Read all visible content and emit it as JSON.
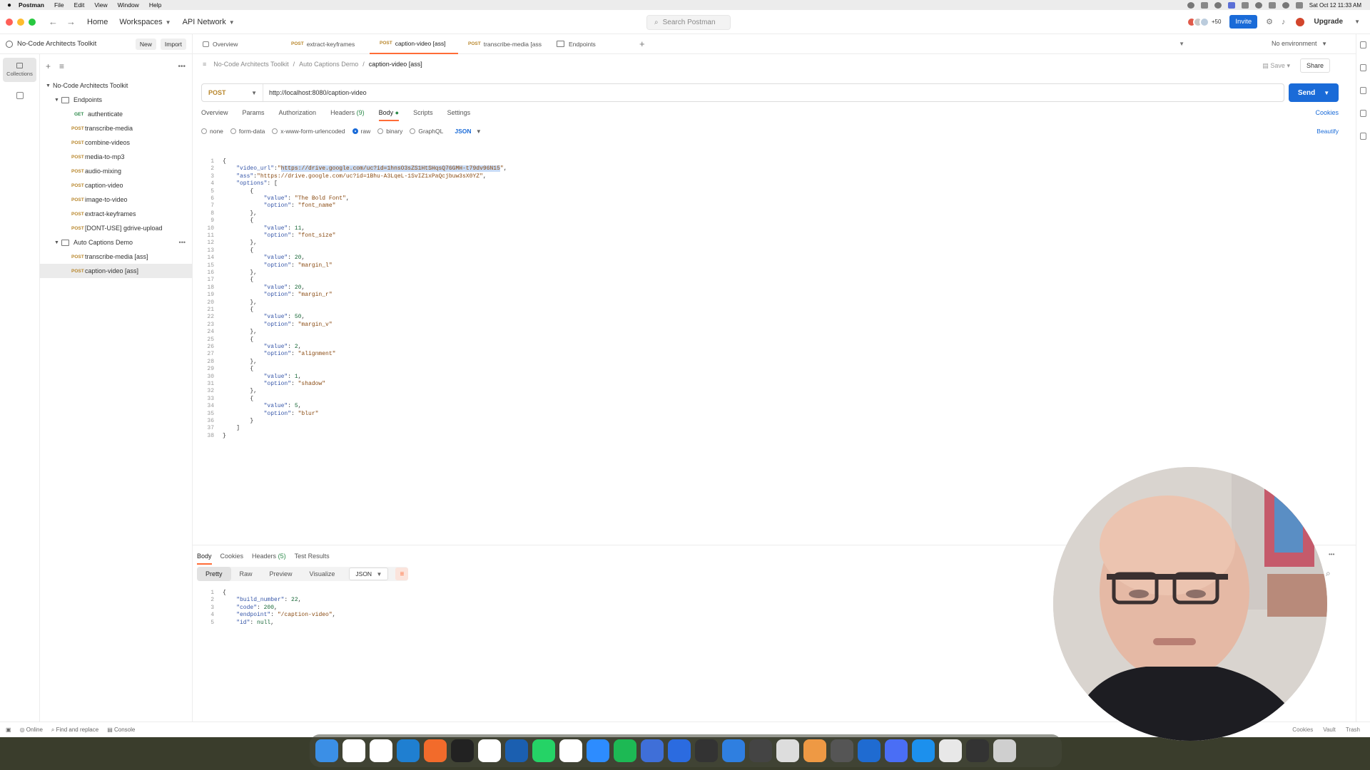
{
  "menubar": {
    "items": [
      "Postman",
      "File",
      "Edit",
      "View",
      "Window",
      "Help"
    ],
    "clock": "Sat Oct 12  11:33 AM"
  },
  "header": {
    "nav": [
      "Home",
      "Workspaces",
      "API Network"
    ],
    "search_placeholder": "Search Postman",
    "avatar_count": "+50",
    "invite": "Invite",
    "upgrade": "Upgrade"
  },
  "sidebar": {
    "workspace": "No-Code Architects Toolkit",
    "new": "New",
    "import": "Import",
    "rail_label": "Collections",
    "collection": "No-Code Architects Toolkit",
    "folder1": "Endpoints",
    "endpoints": [
      {
        "method": "GET",
        "name": "authenticate"
      },
      {
        "method": "POST",
        "name": "transcribe-media"
      },
      {
        "method": "POST",
        "name": "combine-videos"
      },
      {
        "method": "POST",
        "name": "media-to-mp3"
      },
      {
        "method": "POST",
        "name": "audio-mixing"
      },
      {
        "method": "POST",
        "name": "caption-video"
      },
      {
        "method": "POST",
        "name": "image-to-video"
      },
      {
        "method": "POST",
        "name": "extract-keyframes"
      },
      {
        "method": "POST",
        "name": "[DONT-USE] gdrive-upload"
      }
    ],
    "folder2": "Auto Captions Demo",
    "demo": [
      {
        "method": "POST",
        "name": "transcribe-media [ass]"
      },
      {
        "method": "POST",
        "name": "caption-video [ass]"
      }
    ]
  },
  "tabs": [
    {
      "method": "",
      "label": "Overview"
    },
    {
      "method": "POST",
      "label": "extract-keyframes"
    },
    {
      "method": "POST",
      "label": "caption-video [ass]"
    },
    {
      "method": "POST",
      "label": "transcribe-media [ass"
    },
    {
      "method": "",
      "label": "Endpoints"
    }
  ],
  "environment": "No environment",
  "breadcrumb": {
    "a": "No-Code Architects Toolkit",
    "b": "Auto Captions Demo",
    "c": "caption-video [ass]"
  },
  "actions": {
    "save": "Save",
    "share": "Share"
  },
  "request": {
    "method": "POST",
    "url": "http://localhost:8080/caption-video",
    "send": "Send"
  },
  "request_tabs": {
    "overview": "Overview",
    "params": "Params",
    "authorization": "Authorization",
    "headers": "Headers",
    "headers_count": "(9)",
    "body": "Body",
    "scripts": "Scripts",
    "settings": "Settings",
    "cookies": "Cookies"
  },
  "body_options": {
    "none": "none",
    "form_data": "form-data",
    "urlencoded": "x-www-form-urlencoded",
    "raw": "raw",
    "binary": "binary",
    "graphql": "GraphQL",
    "lang": "JSON",
    "beautify": "Beautify"
  },
  "body_lines": [
    "{",
    "    \"video_url\":\"https://drive.google.com/uc?id=1hnsO3sZS1HtSHqsQ76GMH-t79dv96N15\",",
    "    \"ass\":\"https://drive.google.com/uc?id=1Bhu-A3LqeL-1SvIZ1xPaQcjbuw3sX0YZ\",",
    "    \"options\": [",
    "        {",
    "            \"value\": \"The Bold Font\",",
    "            \"option\": \"font_name\"",
    "        },",
    "        {",
    "            \"value\": 11,",
    "            \"option\": \"font_size\"",
    "        },",
    "        {",
    "            \"value\": 20,",
    "            \"option\": \"margin_l\"",
    "        },",
    "        {",
    "            \"value\": 20,",
    "            \"option\": \"margin_r\"",
    "        },",
    "        {",
    "            \"value\": 50,",
    "            \"option\": \"margin_v\"",
    "        },",
    "        {",
    "            \"value\": 2,",
    "            \"option\": \"alignment\"",
    "        },",
    "        {",
    "            \"value\": 1,",
    "            \"option\": \"shadow\"",
    "        },",
    "        {",
    "            \"value\": 5,",
    "            \"option\": \"blur\"",
    "        }",
    "    ]",
    "}"
  ],
  "response": {
    "tabs": {
      "body": "Body",
      "cookies": "Cookies",
      "headers": "Headers",
      "headers_count": "(5)",
      "tests": "Test Results"
    },
    "views": [
      "Pretty",
      "Raw",
      "Preview",
      "Visualize"
    ],
    "lang": "JSON",
    "lines": [
      "{",
      "    \"build_number\": 22,",
      "    \"code\": 200,",
      "    \"endpoint\": \"/caption-video\",",
      "    \"id\": null,"
    ]
  },
  "status": {
    "online": "Online",
    "find": "Find and replace",
    "console": "Console",
    "cookies": "Cookies",
    "vault": "Vault",
    "trash": "Trash"
  },
  "dock_apps": [
    "finder-icon",
    "chrome-icon",
    "chatgpt-icon",
    "vscode-icon",
    "pen-icon",
    "terminal-icon",
    "notion-icon",
    "live-icon",
    "whatsapp-icon",
    "slack-icon",
    "zoom-icon",
    "spotify-icon",
    "docs-icon",
    "1password-icon",
    "music-icon",
    "safari-icon",
    "settings-icon",
    "mail-icon",
    "grid-icon",
    "dash-icon",
    "globe-icon",
    "gear-icon",
    "docker-icon",
    "file-icon",
    "screen-icon",
    "trash-icon"
  ],
  "colors": {
    "accent": "#ff6c37",
    "send": "#1a6bd8",
    "post": "#b8862b",
    "get": "#2c8a4a"
  }
}
